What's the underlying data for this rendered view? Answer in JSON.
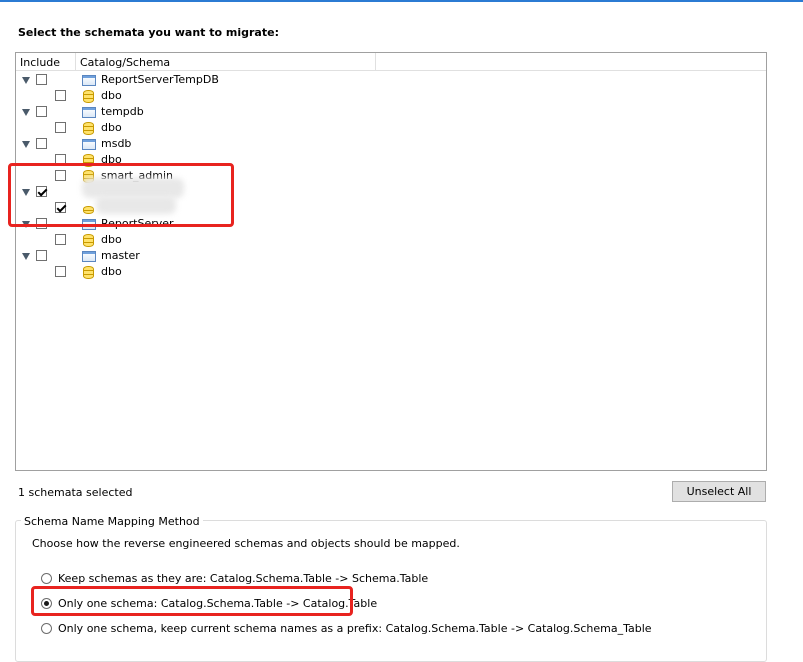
{
  "heading": "Select the schemata you want to migrate:",
  "columns": {
    "include": "Include",
    "catalog": "Catalog/Schema"
  },
  "catalogs": [
    {
      "name": "ReportServerTempDB",
      "checked": false,
      "schemas": [
        {
          "name": "dbo",
          "checked": false
        }
      ]
    },
    {
      "name": "tempdb",
      "checked": false,
      "schemas": [
        {
          "name": "dbo",
          "checked": false
        }
      ]
    },
    {
      "name": "msdb",
      "checked": false,
      "schemas": [
        {
          "name": "dbo",
          "checked": false
        },
        {
          "name": "smart_admin",
          "checked": false
        }
      ]
    },
    {
      "name": "",
      "checked": true,
      "redacted": true,
      "schemas": [
        {
          "name": "",
          "checked": true,
          "redacted": true
        }
      ]
    },
    {
      "name": "ReportServer",
      "checked": false,
      "schemas": [
        {
          "name": "dbo",
          "checked": false
        }
      ]
    },
    {
      "name": "master",
      "checked": false,
      "schemas": [
        {
          "name": "dbo",
          "checked": false
        }
      ]
    }
  ],
  "status": "1 schemata selected",
  "unselect_label": "Unselect All",
  "mapping": {
    "title": "Schema Name Mapping Method",
    "description": "Choose how the reverse engineered schemas and objects should be mapped.",
    "options": [
      {
        "label": "Keep schemas as they are: Catalog.Schema.Table -> Schema.Table",
        "selected": false
      },
      {
        "label": "Only one schema: Catalog.Schema.Table -> Catalog.Table",
        "selected": true
      },
      {
        "label": "Only one schema, keep current schema names as a prefix: Catalog.Schema.Table -> Catalog.Schema_Table",
        "selected": false
      }
    ]
  },
  "colors": {
    "highlight": "#e8231f",
    "accent": "#2b7bd3"
  }
}
